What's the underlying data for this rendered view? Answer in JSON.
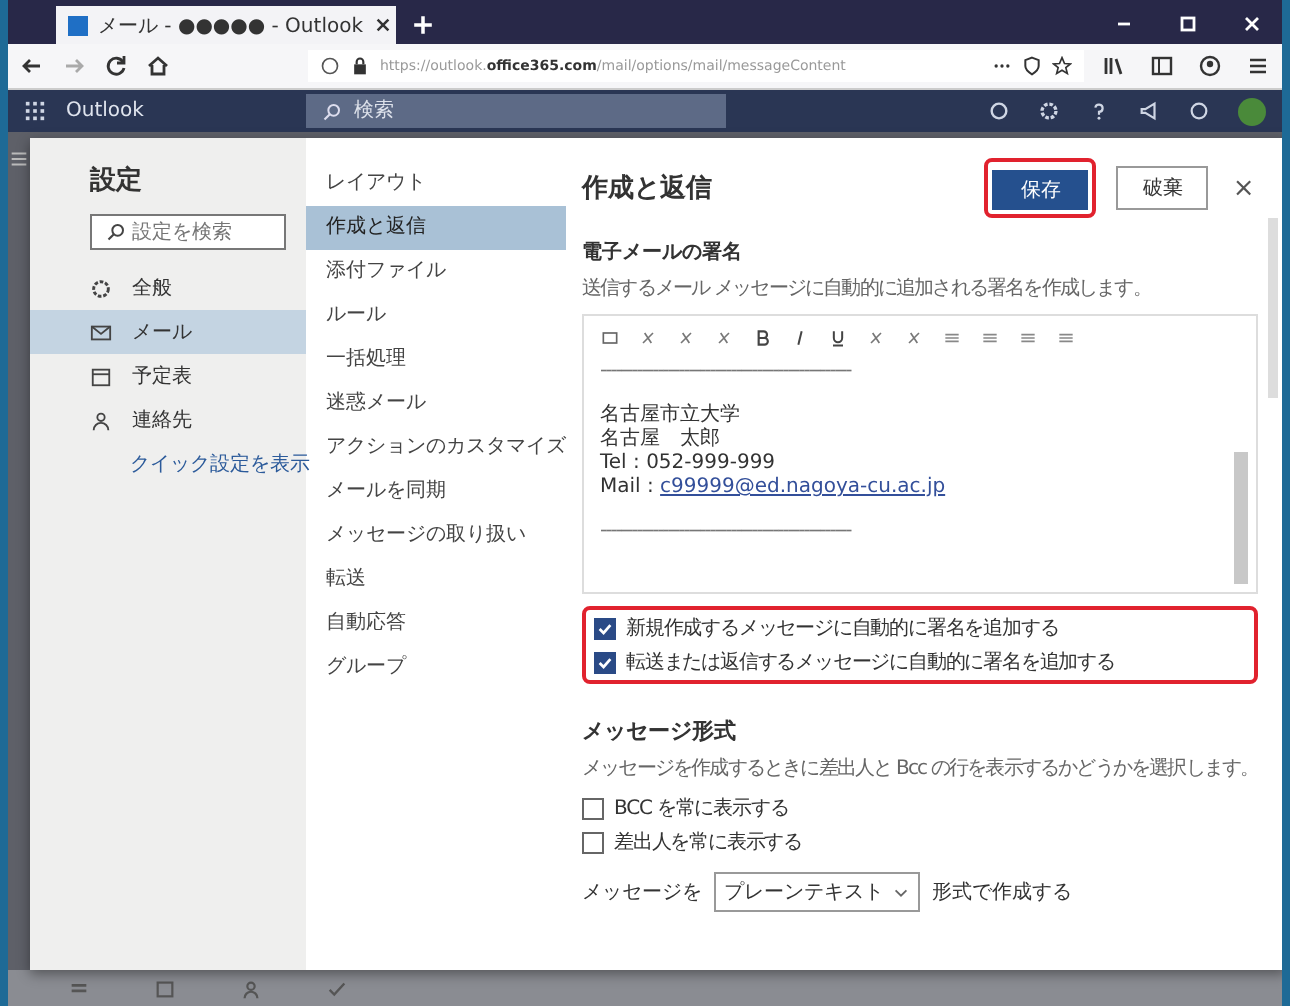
{
  "browser": {
    "tab_title": "メール - ●●●●● - Outlook",
    "url_prefix": "https://outlook.",
    "url_domain": "office365.com",
    "url_path": "/mail/options/mail/messageContent"
  },
  "app_bar": {
    "title": "Outlook",
    "search_placeholder": "検索"
  },
  "settings": {
    "title": "設定",
    "search_placeholder": "設定を検索",
    "categories": [
      {
        "label": "全般",
        "selected": false
      },
      {
        "label": "メール",
        "selected": true
      },
      {
        "label": "予定表",
        "selected": false
      },
      {
        "label": "連絡先",
        "selected": false
      }
    ],
    "quick_link": "クイック設定を表示"
  },
  "subnav": [
    {
      "label": "レイアウト",
      "selected": false
    },
    {
      "label": "作成と返信",
      "selected": true
    },
    {
      "label": "添付ファイル",
      "selected": false
    },
    {
      "label": "ルール",
      "selected": false
    },
    {
      "label": "一括処理",
      "selected": false
    },
    {
      "label": "迷惑メール",
      "selected": false
    },
    {
      "label": "アクションのカスタマイズ",
      "selected": false
    },
    {
      "label": "メールを同期",
      "selected": false
    },
    {
      "label": "メッセージの取り扱い",
      "selected": false
    },
    {
      "label": "転送",
      "selected": false
    },
    {
      "label": "自動応答",
      "selected": false
    },
    {
      "label": "グループ",
      "selected": false
    }
  ],
  "pane": {
    "title": "作成と返信",
    "save": "保存",
    "discard": "破棄",
    "close": "×",
    "signature": {
      "heading": "電子メールの署名",
      "description": "送信するメール メッセージに自動的に追加される署名を作成します。",
      "lines": [
        "------------------------------------------------",
        "名古屋市立大学",
        "名古屋　太郎",
        "Tel : 052-999-999"
      ],
      "mail_label": "Mail : ",
      "mail_link": "c99999@ed.nagoya-cu.ac.jp",
      "closing_line": "------------------------------------------------"
    },
    "signature_options": [
      {
        "label": "新規作成するメッセージに自動的に署名を追加する",
        "checked": true
      },
      {
        "label": "転送または返信するメッセージに自動的に署名を追加する",
        "checked": true
      }
    ],
    "format": {
      "heading": "メッセージ形式",
      "description": "メッセージを作成するときに差出人と Bcc の行を表示するかどうかを選択します。",
      "options": [
        {
          "label": "BCC を常に表示する",
          "checked": false
        },
        {
          "label": "差出人を常に表示する",
          "checked": false
        }
      ],
      "compose_prefix": "メッセージを",
      "compose_value": "プレーンテキスト",
      "compose_suffix": "形式で作成する"
    }
  }
}
